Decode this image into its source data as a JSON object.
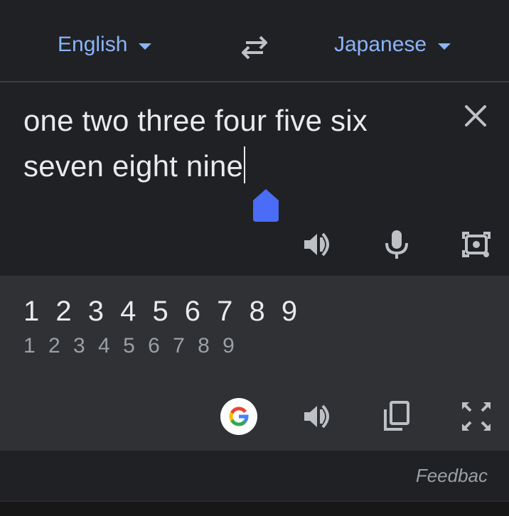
{
  "language_bar": {
    "source_language": "English",
    "target_language": "Japanese",
    "swap_icon": "swap-arrows-icon"
  },
  "input": {
    "text": "one two three four five six seven eight nine",
    "line1": "one two three four five six",
    "line2": "seven eight nine",
    "clear_icon": "close-icon",
    "actions": [
      "speaker-icon",
      "microphone-icon",
      "camera-icon"
    ]
  },
  "output": {
    "translation": "1 2 3 4 5 6 7 8 9",
    "romanization": "1 2 3 4 5 6 7 8 9",
    "actions": [
      "google-logo-icon",
      "speaker-icon",
      "copy-icon",
      "fullscreen-icon"
    ]
  },
  "footer": {
    "feedback_label": "Feedbac"
  },
  "colors": {
    "background": "#202124",
    "output_background": "#303134",
    "accent": "#8ab4f8",
    "text_primary": "#e8eaed",
    "text_secondary": "#9aa0a6",
    "selection_handle": "#4a6cf7",
    "divider": "#3c4043"
  }
}
